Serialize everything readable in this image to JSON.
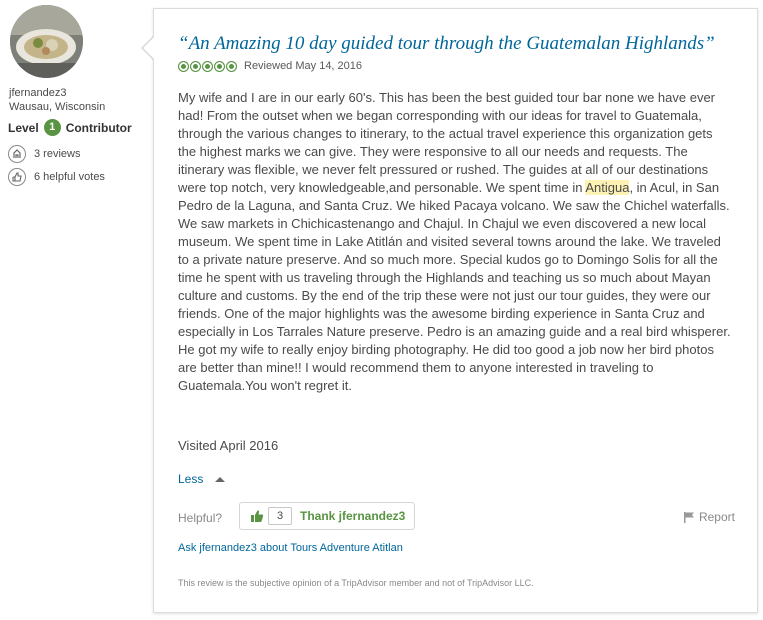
{
  "member": {
    "username": "jfernandez3",
    "location": "Wausau, Wisconsin",
    "level_prefix": "Level",
    "level_number": "1",
    "level_title": "Contributor",
    "reviews": "3 reviews",
    "helpful_votes": "6 helpful votes"
  },
  "review": {
    "title": "“An Amazing 10 day guided tour through the Guatemalan Highlands”",
    "rating_bubbles": 5,
    "reviewed_date": "Reviewed May 14, 2016",
    "body_before": "My wife and I are in our early 60's. This has been the best guided tour bar none we have ever had! From the outset when we began corresponding with our ideas for travel to Guatemala, through the various changes to itinerary, to the actual travel experience this organization gets the highest marks we can give. They were responsive to all our needs and requests. The itinerary was flexible, we never felt pressured or rushed. The guides at all of our destinations were top notch, very knowledgeable,and personable. We spent time in ",
    "body_highlight": "Antigua",
    "body_after": ", in Acul, in San Pedro de la Laguna, and Santa Cruz. We hiked Pacaya volcano. We saw the Chichel waterfalls. We saw markets in Chichicastenango and Chajul. In Chajul we even discovered a new local museum. We spent time in Lake Atitlán and visited several towns around the lake. We traveled to a private nature preserve. And so much more. Special kudos go to Domingo Solis for all the time he spent with us traveling through the Highlands and teaching us so much about Mayan culture and customs. By the end of the trip these were not just our tour guides, they were our friends. One of the major highlights was the awesome birding experience in Santa Cruz and especially in Los Tarrales Nature preserve. Pedro is an amazing guide and a real bird whisperer. He got my wife to really enjoy birding photography. He did too good a job now her bird photos are better than mine!! I would recommend them to anyone interested in traveling to Guatemala.You won't regret it.",
    "visited": "Visited April 2016",
    "less_label": "Less",
    "helpful_label": "Helpful?",
    "thank_count": "3",
    "thank_label": "Thank jfernandez3",
    "report_label": "Report",
    "ask_label": "Ask jfernandez3 about Tours Adventure Atitlan",
    "disclaimer": "This review is the subjective opinion of a TripAdvisor member and not of TripAdvisor LLC."
  },
  "colors": {
    "link": "#006699",
    "bubble_green": "#589442",
    "highlight": "#fcf2b3"
  }
}
